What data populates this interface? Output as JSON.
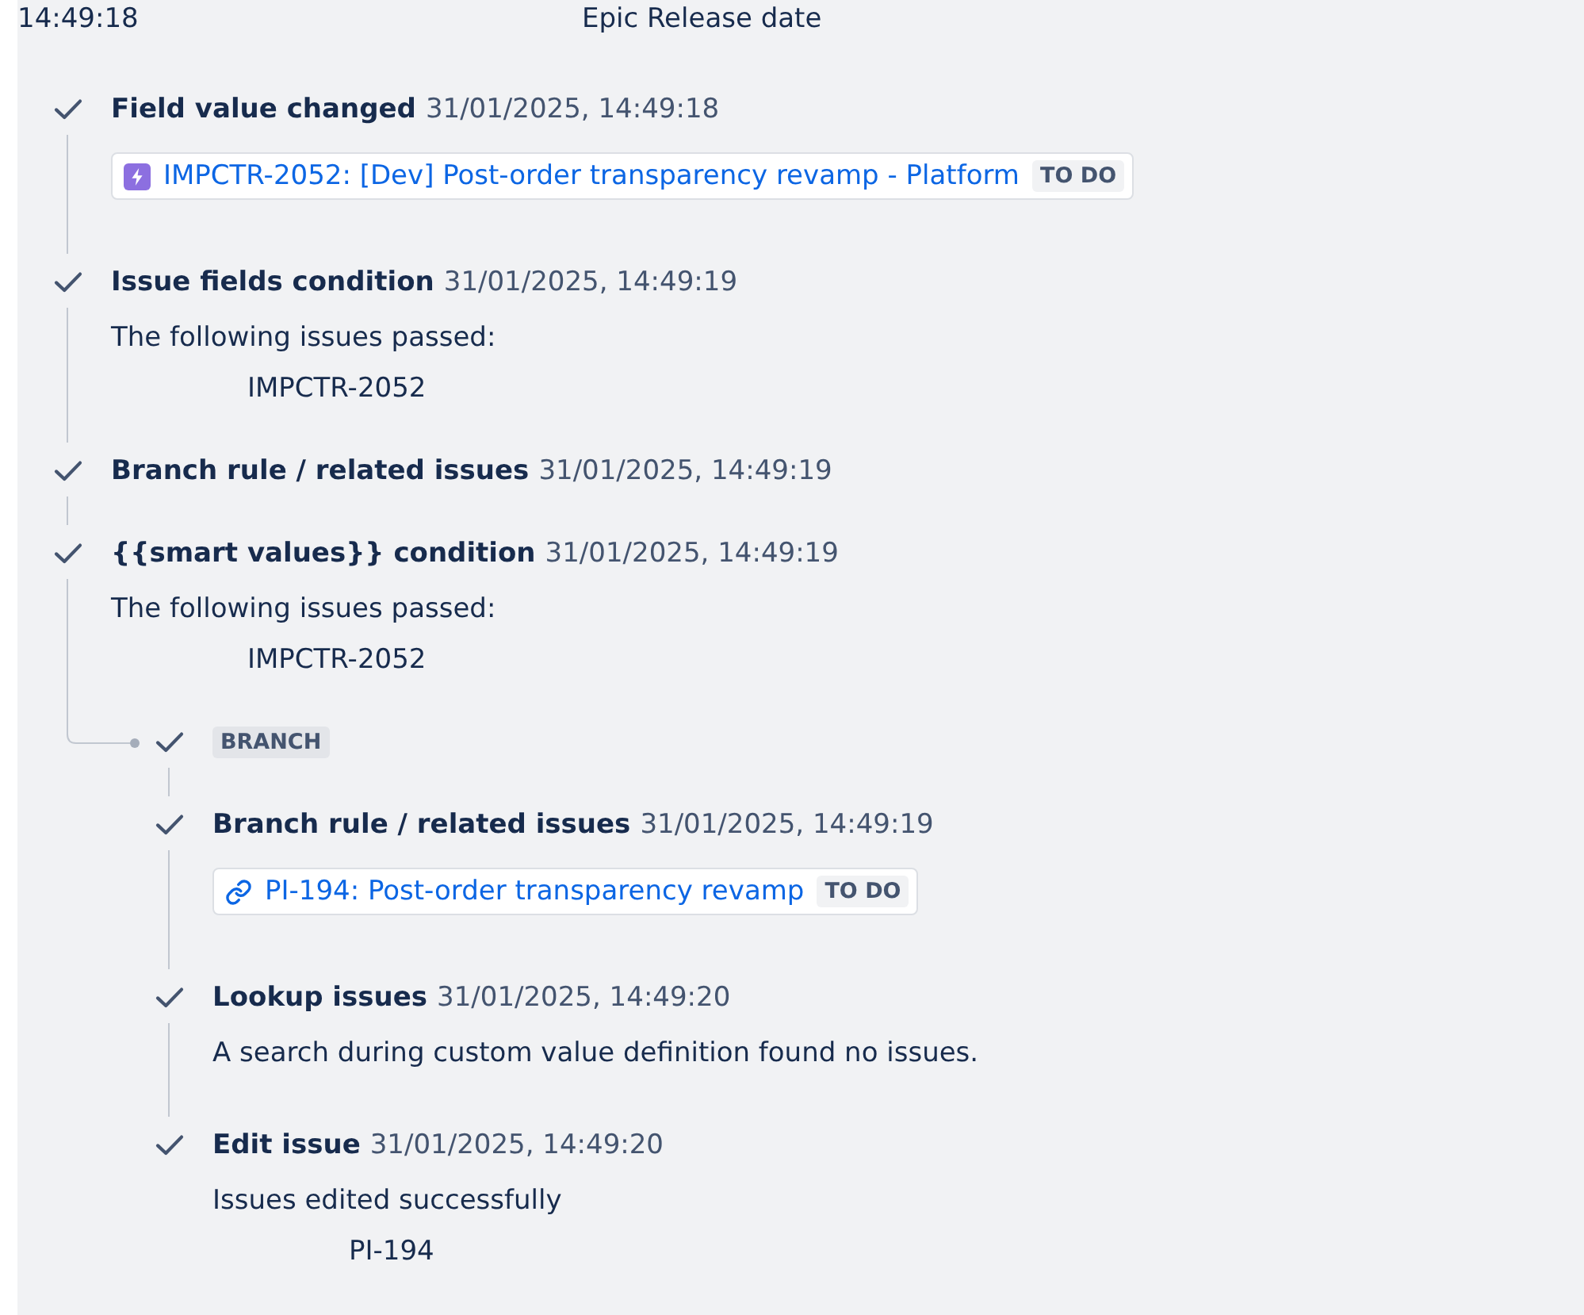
{
  "header": {
    "time": "14:49:18",
    "field": "Epic Release date"
  },
  "steps": [
    {
      "kind": "action",
      "completed": true,
      "title": "Field value changed",
      "timestamp": "31/01/2025, 14:49:18",
      "issue_card": {
        "kind": "epic",
        "label": "IMPCTR-2052: [Dev] Post-order transparency revamp - Platform",
        "status": "TO DO"
      }
    },
    {
      "kind": "action",
      "completed": true,
      "title": "Issue fields condition",
      "timestamp": "31/01/2025, 14:49:19",
      "message": "The following issues passed:",
      "issues": [
        "IMPCTR-2052"
      ]
    },
    {
      "kind": "action",
      "completed": true,
      "title": "Branch rule / related issues",
      "timestamp": "31/01/2025, 14:49:19"
    },
    {
      "kind": "action",
      "completed": true,
      "title": "{{smart values}} condition",
      "timestamp": "31/01/2025, 14:49:19",
      "message": "The following issues passed:",
      "issues": [
        "IMPCTR-2052"
      ]
    },
    {
      "kind": "branch",
      "completed": true,
      "label": "BRANCH",
      "children": [
        {
          "kind": "action",
          "completed": true,
          "title": "Branch rule / related issues",
          "timestamp": "31/01/2025, 14:49:19",
          "issue_card": {
            "kind": "link",
            "label": "PI-194: Post-order transparency revamp",
            "status": "TO DO"
          }
        },
        {
          "kind": "action",
          "completed": true,
          "title": "Lookup issues",
          "timestamp": "31/01/2025, 14:49:20",
          "message": "A search during custom value definition found no issues."
        },
        {
          "kind": "action",
          "completed": true,
          "title": "Edit issue",
          "timestamp": "31/01/2025, 14:49:20",
          "message": "Issues edited successfully",
          "issues": [
            "PI-194"
          ]
        }
      ]
    }
  ]
}
